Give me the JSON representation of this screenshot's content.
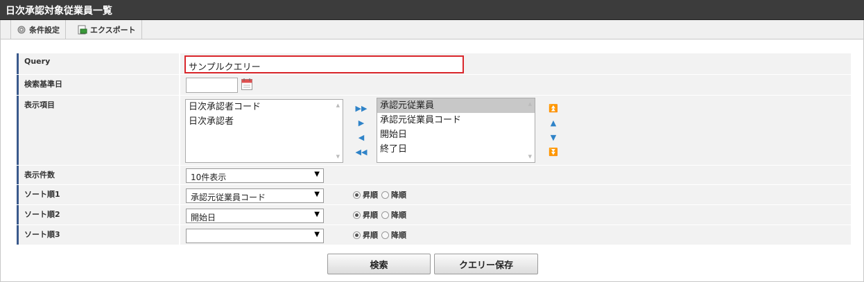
{
  "window": {
    "title": "日次承認対象従業員一覧"
  },
  "toolbar": {
    "conditions_label": "条件設定",
    "export_label": "エクスポート"
  },
  "form": {
    "query": {
      "label": "Query",
      "value": "サンプルクエリー"
    },
    "base_date": {
      "label": "検索基準日",
      "value": ""
    },
    "display_items": {
      "label": "表示項目",
      "available": [
        "日次承認者コード",
        "日次承認者"
      ],
      "selected": [
        "承認元従業員",
        "承認元従業員コード",
        "開始日",
        "終了日"
      ],
      "highlighted_selected": "承認元従業員"
    },
    "display_count": {
      "label": "表示件数",
      "value": "10件表示"
    },
    "sort1": {
      "label": "ソート順1",
      "value": "承認元従業員コード",
      "asc_label": "昇順",
      "desc_label": "降順",
      "order": "asc"
    },
    "sort2": {
      "label": "ソート順2",
      "value": "開始日",
      "asc_label": "昇順",
      "desc_label": "降順",
      "order": "asc"
    },
    "sort3": {
      "label": "ソート順3",
      "value": "",
      "asc_label": "昇順",
      "desc_label": "降順",
      "order": "asc"
    }
  },
  "buttons": {
    "search_label": "検索",
    "save_query_label": "クエリー保存"
  },
  "colors": {
    "title_bg": "#3c3c3c",
    "label_accent": "#3a5a8c",
    "query_highlight": "#d9262b",
    "move_arrows": "#2f83c8"
  }
}
